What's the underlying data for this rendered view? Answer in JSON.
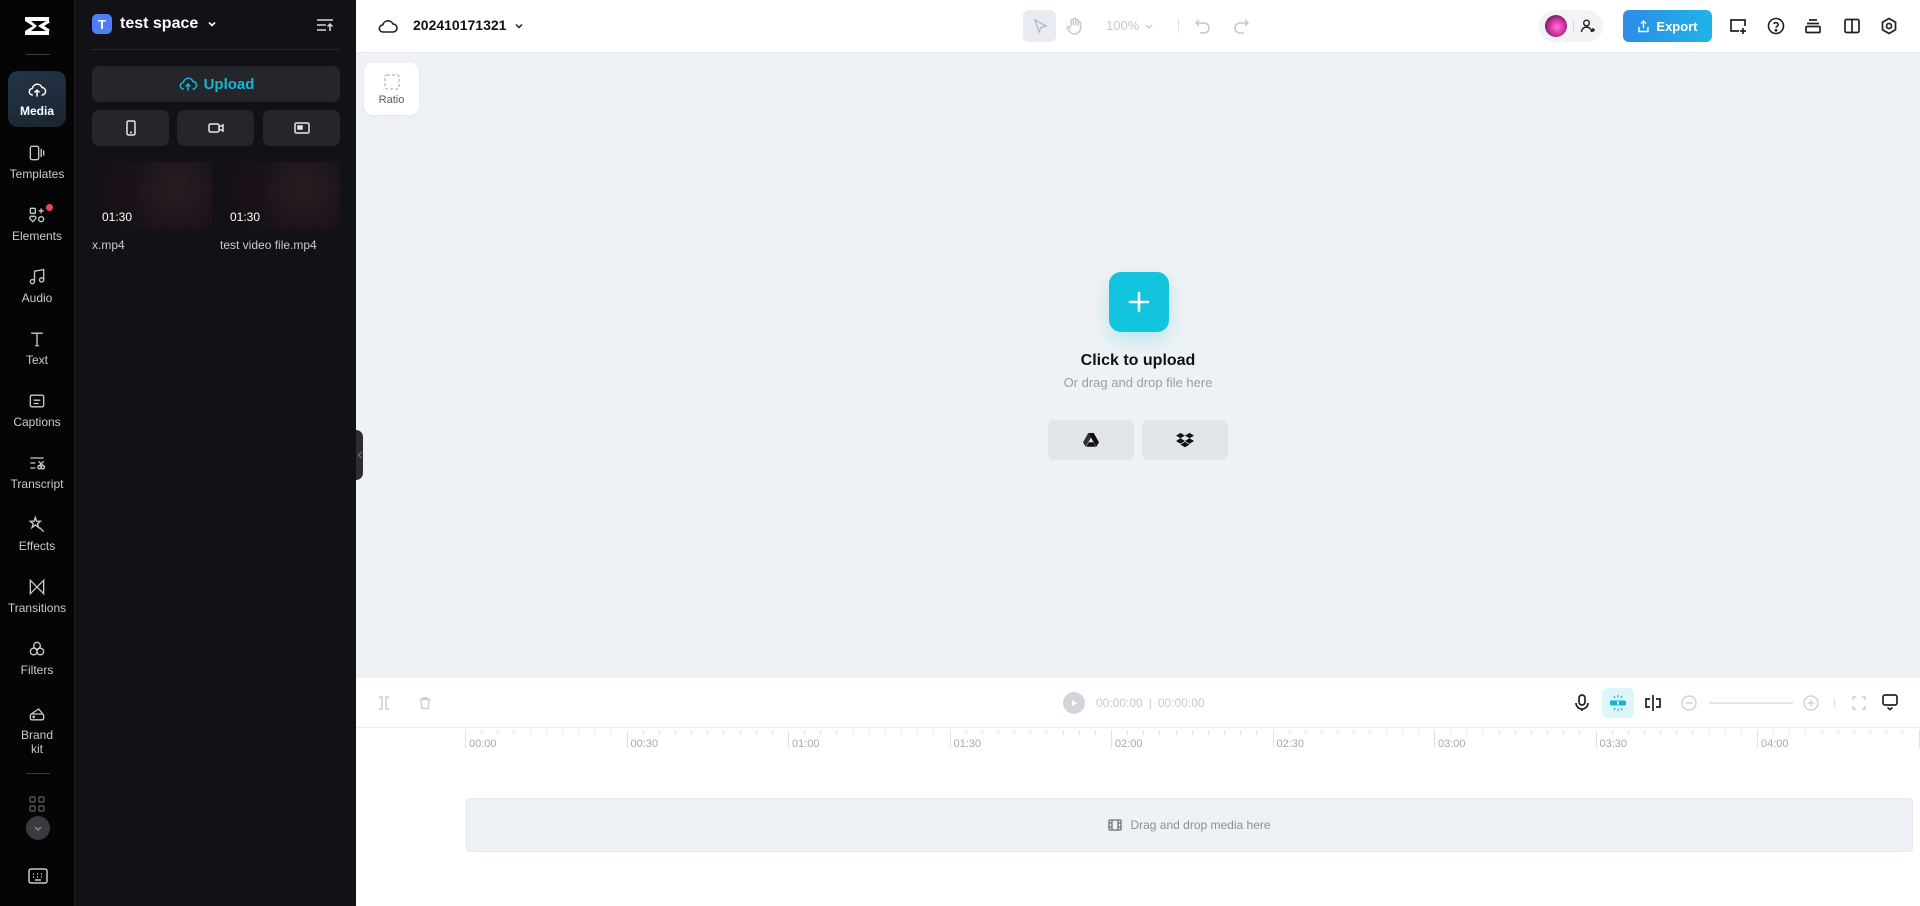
{
  "rail": {
    "items": [
      {
        "label": "Media",
        "icon": "cloud-upload-icon",
        "active": true
      },
      {
        "label": "Templates",
        "icon": "templates-icon"
      },
      {
        "label": "Elements",
        "icon": "elements-icon",
        "badge": true
      },
      {
        "label": "Audio",
        "icon": "music-note-icon"
      },
      {
        "label": "Text",
        "icon": "text-icon"
      },
      {
        "label": "Captions",
        "icon": "captions-icon"
      },
      {
        "label": "Transcript",
        "icon": "transcript-icon"
      },
      {
        "label": "Effects",
        "icon": "effects-icon"
      },
      {
        "label": "Transitions",
        "icon": "transitions-icon"
      },
      {
        "label": "Filters",
        "icon": "filters-icon"
      },
      {
        "label": "Brand\nkit",
        "icon": "brand-kit-icon"
      }
    ]
  },
  "panel": {
    "space_initial": "T",
    "space_name": "test space",
    "upload_label": "Upload",
    "source_buttons": [
      "phone-icon",
      "camera-icon",
      "screen-record-icon"
    ],
    "media": [
      {
        "name": "x.mp4",
        "duration": "01:30"
      },
      {
        "name": "test video file.mp4",
        "duration": "01:30"
      }
    ]
  },
  "topbar": {
    "project_name": "202410171321",
    "zoom_level": "100%",
    "export_label": "Export"
  },
  "canvas": {
    "ratio_label": "Ratio",
    "upload_title": "Click to upload",
    "upload_subtitle": "Or drag and drop file here",
    "cloud_sources": [
      "google-drive-icon",
      "dropbox-icon"
    ]
  },
  "timeline": {
    "current_time": "00:00:00",
    "total_time": "00:00:00",
    "ruler_labels": [
      "00:00",
      "00:30",
      "01:00",
      "01:30",
      "02:00",
      "02:30",
      "03:00",
      "03:30",
      "04:00"
    ],
    "drop_hint": "Drag and drop media here"
  },
  "colors": {
    "accent": "#13c4de",
    "export": "#2e8be8",
    "rail_bg": "#050505",
    "panel_bg": "#111116"
  }
}
